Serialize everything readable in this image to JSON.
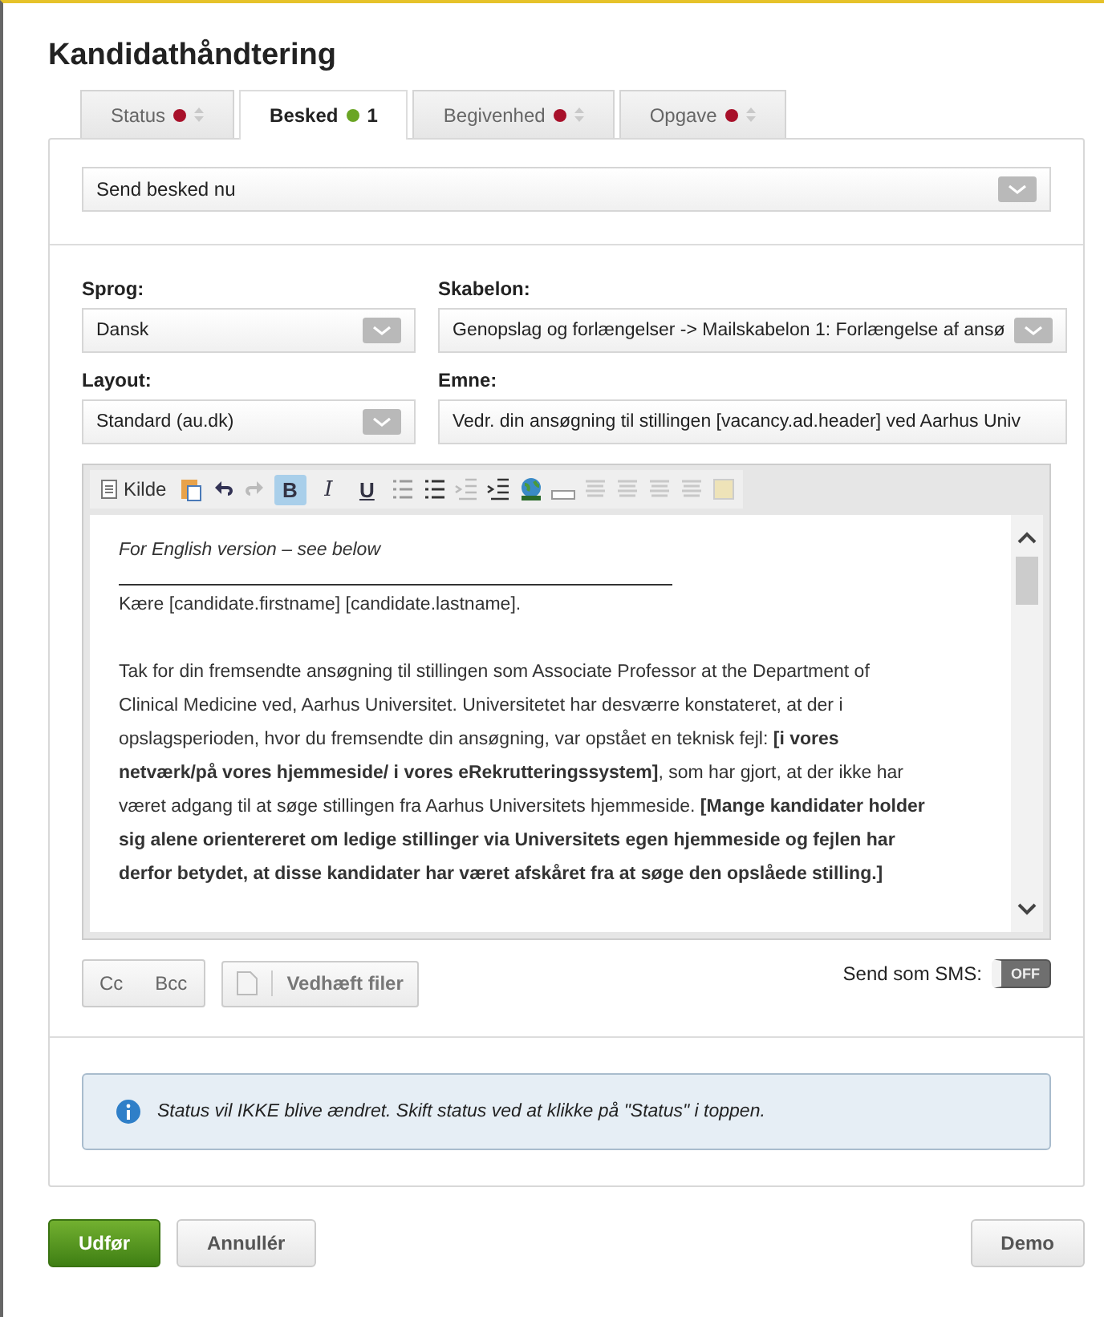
{
  "title": "Kandidathåndtering",
  "tabs": [
    {
      "label": "Status",
      "color": "#a8102a",
      "selected": false
    },
    {
      "label": "Besked",
      "color": "#6aa524",
      "count": "1",
      "selected": true
    },
    {
      "label": "Begivenhed",
      "color": "#a8102a",
      "selected": false
    },
    {
      "label": "Opgave",
      "color": "#a8102a",
      "selected": false
    }
  ],
  "send_mode": {
    "value": "Send besked nu"
  },
  "fields": [
    {
      "label": "Sprog:",
      "value": "Dansk",
      "kind": "select"
    },
    {
      "label": "Skabelon:",
      "value": "Genopslag og forlængelser -> Mailskabelon 1: Forlængelse af ansø",
      "kind": "select"
    },
    {
      "label": "Layout:",
      "value": "Standard (au.dk)",
      "kind": "select"
    },
    {
      "label": "Emne:",
      "value": "Vedr. din ansøgning til stillingen [vacancy.ad.header] ved Aarhus Univ",
      "kind": "text"
    }
  ],
  "toolbar": [
    {
      "kind": "source",
      "label": "Kilde"
    },
    {
      "kind": "paste"
    },
    {
      "kind": "undo"
    },
    {
      "kind": "redo"
    },
    {
      "kind": "bold",
      "label": "B",
      "selected": true
    },
    {
      "kind": "italic",
      "label": "I",
      "selected": false
    },
    {
      "kind": "underline",
      "label": "U",
      "selected": false
    },
    {
      "kind": "numbered-list"
    },
    {
      "kind": "bullet-list"
    },
    {
      "kind": "outdent"
    },
    {
      "kind": "indent"
    },
    {
      "kind": "globe"
    },
    {
      "kind": "field"
    },
    {
      "kind": "align-left"
    },
    {
      "kind": "align-center"
    },
    {
      "kind": "align-right"
    },
    {
      "kind": "justify"
    },
    {
      "kind": "image"
    }
  ],
  "editor": [
    {
      "kind": "italic",
      "text": "For English version – see below"
    },
    {
      "kind": "rule"
    },
    {
      "kind": "text",
      "text": "Kære [candidate.firstname] [candidate.lastname]."
    },
    {
      "kind": "text",
      "text": "Tak for din fremsendte ansøgning til stillingen som Associate Professor at the Department of Clinical Medicine  ved, Aarhus Universitet. Universitetet har desværre konstateret, at der i opslagsperioden, hvor du fremsendte din ansøgning, var opstået en teknisk fejl:  **[i vores netværk/på vores hjemmeside/ i vores eRekrutteringssystem]**, som har gjort, at der ikke har været adgang til at søge stillingen fra Aarhus Universitets hjemmeside. **[Mange kandidater holder sig alene orientereret om ledige stillinger via Universitets egen hjemmeside og fejlen har derfor betydet, at disse kandidater har været afskåret fra at søge den opslåede stilling.]**"
    }
  ],
  "buttons": [
    {
      "label": "Cc"
    },
    {
      "label": "Bcc"
    },
    {
      "label": "Vedhæft filer"
    }
  ],
  "sms": {
    "label": "Send som SMS:",
    "on": false,
    "state_text": "OFF"
  },
  "info": "Status vil IKKE blive ændret. Skift status ved at klikke på \"Status\" i toppen.",
  "footer": [
    {
      "label": "Udfør",
      "kind": "primary"
    },
    {
      "label": "Annullér",
      "kind": "default"
    },
    {
      "label": "Demo",
      "kind": "right"
    }
  ]
}
